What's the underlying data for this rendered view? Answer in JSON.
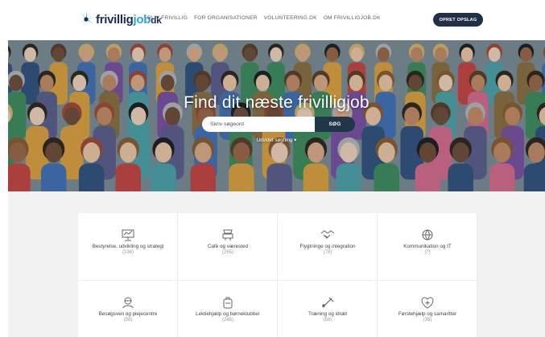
{
  "brand": {
    "name_main": "frivillig",
    "name_accent": "job",
    "name_suffix": "dk",
    "primary": "#1c2c55",
    "accent": "#2fa3d9"
  },
  "nav": [
    {
      "label": "BLIV FRIVILLIG"
    },
    {
      "label": "FOR ORGANISATIONER"
    },
    {
      "label": "VOLUNTEERING.DK"
    },
    {
      "label": "OM FRIVILLIGJOB.DK"
    }
  ],
  "cta_label": "OPRET OPSLAG",
  "hero": {
    "title": "Find dit næste frivilligjob",
    "search_placeholder": "Skriv søgeord",
    "search_button": "SØG",
    "advanced_search": "Udvidet søgning ▾"
  },
  "categories": [
    {
      "name": "Bestyrelse, udvikling og strategi",
      "count": "(198)",
      "icon": "board-icon"
    },
    {
      "name": "Café og værested",
      "count": "(265)",
      "icon": "cafe-icon"
    },
    {
      "name": "Flygtninge og integration",
      "count": "(78)",
      "icon": "handshake-icon"
    },
    {
      "name": "Kommunikation og IT",
      "count": "(7)",
      "icon": "globe-icon"
    },
    {
      "name": "Besøgsven og plejecentre",
      "count": "(58)",
      "icon": "visitor-icon"
    },
    {
      "name": "Lektiehjælp og børneklubber",
      "count": "(246)",
      "icon": "backpack-icon"
    },
    {
      "name": "Træning og idræt",
      "count": "(58)",
      "icon": "badminton-icon"
    },
    {
      "name": "Førstehjælp og samaritter",
      "count": "(35)",
      "icon": "first-aid-icon"
    }
  ]
}
